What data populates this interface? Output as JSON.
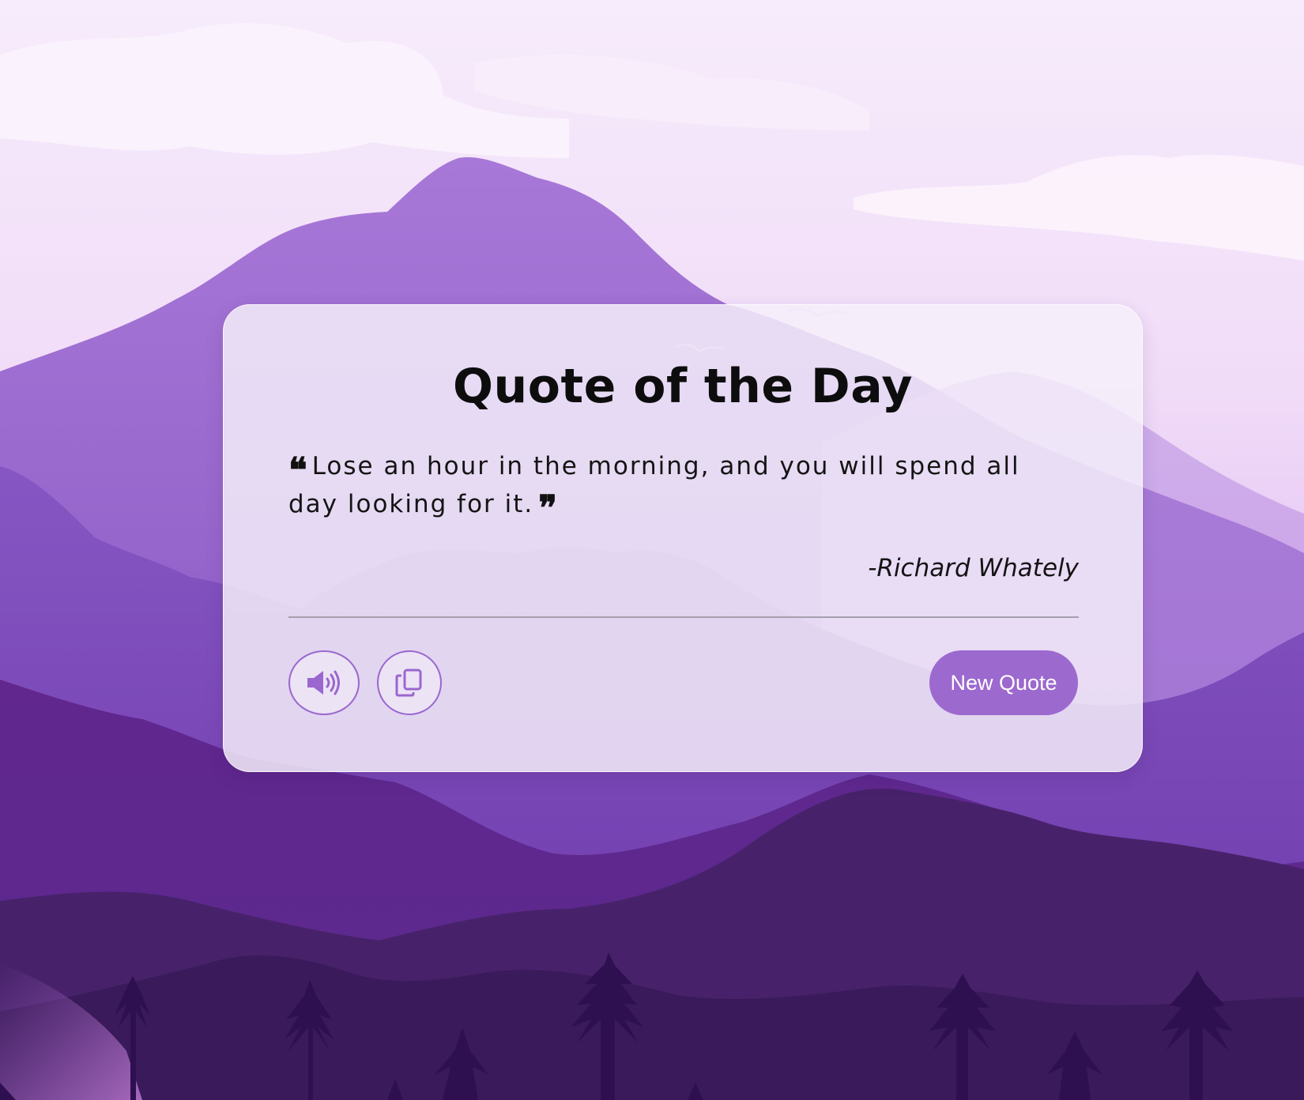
{
  "card": {
    "title": "Quote of the Day",
    "quote_text": "Lose an hour in the morning, and you will spend all day looking for it.",
    "open_mark": "❝",
    "close_mark": "❞",
    "author": "-Richard Whately"
  },
  "actions": {
    "speak_icon": "speaker-icon",
    "copy_icon": "copy-icon",
    "new_quote_label": "New Quote"
  },
  "colors": {
    "accent": "#9c69cf",
    "accent_border": "#9a67cf",
    "sky_top": "#f3e6fb",
    "mountain_dark": "#47226a",
    "trees": "#2e1050"
  }
}
